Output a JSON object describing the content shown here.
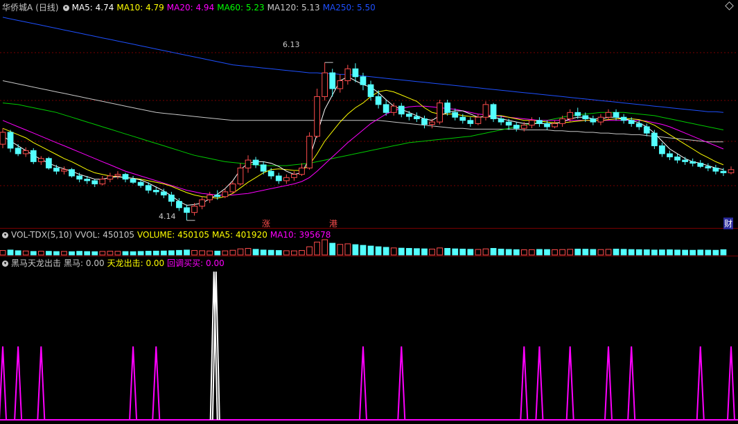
{
  "stock": {
    "name": "华侨城A",
    "period": "(日线)"
  },
  "main_panel": {
    "ma_labels": [
      {
        "text": "MA5: 4.74",
        "color": "#ffffff"
      },
      {
        "text": "MA10: 4.79",
        "color": "#ffff00"
      },
      {
        "text": "MA20: 4.94",
        "color": "#ff00ff"
      },
      {
        "text": "MA60: 5.23",
        "color": "#00ff00"
      },
      {
        "text": "MA120: 5.13",
        "color": "#c8c8c8"
      },
      {
        "text": "MA250: 5.50",
        "color": "#1e50ff"
      }
    ],
    "high_label": "6.13",
    "low_label": "4.14",
    "markers": [
      "涨",
      "港",
      "财"
    ]
  },
  "volume_panel": {
    "title": "VOL-TDX(5,10)",
    "labels": [
      {
        "text": "VVOL: 450105",
        "color": "#c8c8c8"
      },
      {
        "text": "VOLUME: 450105",
        "color": "#ffff00"
      },
      {
        "text": "MA5: 401920",
        "color": "#ffff00"
      },
      {
        "text": "MA10: 395678",
        "color": "#ff00ff"
      }
    ]
  },
  "indicator_panel": {
    "title": "黑马天龙出击",
    "labels": [
      {
        "text": "黑马: 0.00",
        "color": "#c8c8c8"
      },
      {
        "text": "天龙出击: 0.00",
        "color": "#ffff00"
      },
      {
        "text": "回调买买: 0.00",
        "color": "#ff00ff"
      }
    ]
  },
  "colors": {
    "up": "#ff4d4d",
    "down": "#54ffff",
    "grid": "#7a0000",
    "bg": "#000000"
  },
  "chart_data": {
    "type": "candlestick",
    "price_range": [
      4.14,
      6.13
    ],
    "candles": [
      [
        5.1,
        5.25,
        5.3,
        5.05
      ],
      [
        5.25,
        5.05,
        5.28,
        5.0
      ],
      [
        5.05,
        4.98,
        5.1,
        4.95
      ],
      [
        4.98,
        5.02,
        5.06,
        4.94
      ],
      [
        5.02,
        4.88,
        5.05,
        4.85
      ],
      [
        4.88,
        4.92,
        4.95,
        4.84
      ],
      [
        4.92,
        4.8,
        4.94,
        4.78
      ],
      [
        4.8,
        4.76,
        4.84,
        4.72
      ],
      [
        4.76,
        4.78,
        4.82,
        4.72
      ],
      [
        4.78,
        4.7,
        4.8,
        4.68
      ],
      [
        4.7,
        4.66,
        4.74,
        4.62
      ],
      [
        4.66,
        4.64,
        4.7,
        4.6
      ],
      [
        4.64,
        4.6,
        4.66,
        4.56
      ],
      [
        4.6,
        4.66,
        4.7,
        4.58
      ],
      [
        4.66,
        4.7,
        4.74,
        4.62
      ],
      [
        4.7,
        4.72,
        4.76,
        4.66
      ],
      [
        4.72,
        4.66,
        4.74,
        4.62
      ],
      [
        4.66,
        4.62,
        4.7,
        4.6
      ],
      [
        4.62,
        4.58,
        4.66,
        4.55
      ],
      [
        4.58,
        4.52,
        4.62,
        4.48
      ],
      [
        4.52,
        4.5,
        4.56,
        4.46
      ],
      [
        4.5,
        4.46,
        4.54,
        4.42
      ],
      [
        4.46,
        4.38,
        4.5,
        4.32
      ],
      [
        4.38,
        4.3,
        4.42,
        4.26
      ],
      [
        4.3,
        4.24,
        4.34,
        4.14
      ],
      [
        4.24,
        4.32,
        4.36,
        4.2
      ],
      [
        4.32,
        4.4,
        4.44,
        4.28
      ],
      [
        4.4,
        4.46,
        4.5,
        4.36
      ],
      [
        4.46,
        4.44,
        4.52,
        4.4
      ],
      [
        4.44,
        4.5,
        4.54,
        4.42
      ],
      [
        4.5,
        4.6,
        4.64,
        4.48
      ],
      [
        4.6,
        4.8,
        4.86,
        4.58
      ],
      [
        4.8,
        4.9,
        4.96,
        4.74
      ],
      [
        4.9,
        4.84,
        4.94,
        4.8
      ],
      [
        4.84,
        4.76,
        4.88,
        4.72
      ],
      [
        4.76,
        4.7,
        4.8,
        4.66
      ],
      [
        4.7,
        4.64,
        4.74,
        4.6
      ],
      [
        4.64,
        4.68,
        4.72,
        4.6
      ],
      [
        4.68,
        4.72,
        4.76,
        4.64
      ],
      [
        4.72,
        4.8,
        4.86,
        4.7
      ],
      [
        4.8,
        5.2,
        5.25,
        4.78
      ],
      [
        5.2,
        5.7,
        5.8,
        5.18
      ],
      [
        5.7,
        6.0,
        6.13,
        5.65
      ],
      [
        6.0,
        5.8,
        6.05,
        5.7
      ],
      [
        5.8,
        5.9,
        5.98,
        5.75
      ],
      [
        5.9,
        6.05,
        6.1,
        5.85
      ],
      [
        6.05,
        5.95,
        6.12,
        5.88
      ],
      [
        5.95,
        5.85,
        6.0,
        5.78
      ],
      [
        5.85,
        5.7,
        5.9,
        5.65
      ],
      [
        5.7,
        5.6,
        5.78,
        5.55
      ],
      [
        5.6,
        5.5,
        5.66,
        5.46
      ],
      [
        5.5,
        5.58,
        5.62,
        5.46
      ],
      [
        5.58,
        5.48,
        5.62,
        5.44
      ],
      [
        5.48,
        5.45,
        5.52,
        5.4
      ],
      [
        5.45,
        5.42,
        5.5,
        5.38
      ],
      [
        5.42,
        5.35,
        5.46,
        5.3
      ],
      [
        5.35,
        5.38,
        5.42,
        5.3
      ],
      [
        5.38,
        5.62,
        5.66,
        5.35
      ],
      [
        5.62,
        5.5,
        5.66,
        5.46
      ],
      [
        5.5,
        5.44,
        5.55,
        5.4
      ],
      [
        5.44,
        5.4,
        5.48,
        5.36
      ],
      [
        5.4,
        5.36,
        5.44,
        5.32
      ],
      [
        5.36,
        5.44,
        5.48,
        5.34
      ],
      [
        5.44,
        5.6,
        5.64,
        5.4
      ],
      [
        5.6,
        5.42,
        5.62,
        5.38
      ],
      [
        5.42,
        5.38,
        5.46,
        5.34
      ],
      [
        5.38,
        5.34,
        5.42,
        5.28
      ],
      [
        5.34,
        5.3,
        5.38,
        5.26
      ],
      [
        5.3,
        5.34,
        5.38,
        5.26
      ],
      [
        5.34,
        5.4,
        5.44,
        5.3
      ],
      [
        5.4,
        5.36,
        5.44,
        5.32
      ],
      [
        5.36,
        5.32,
        5.4,
        5.28
      ],
      [
        5.32,
        5.36,
        5.4,
        5.3
      ],
      [
        5.36,
        5.42,
        5.46,
        5.32
      ],
      [
        5.42,
        5.5,
        5.54,
        5.38
      ],
      [
        5.5,
        5.46,
        5.56,
        5.42
      ],
      [
        5.46,
        5.42,
        5.5,
        5.38
      ],
      [
        5.42,
        5.38,
        5.46,
        5.34
      ],
      [
        5.38,
        5.44,
        5.48,
        5.34
      ],
      [
        5.44,
        5.5,
        5.54,
        5.4
      ],
      [
        5.5,
        5.44,
        5.54,
        5.4
      ],
      [
        5.44,
        5.4,
        5.48,
        5.36
      ],
      [
        5.4,
        5.36,
        5.44,
        5.32
      ],
      [
        5.36,
        5.32,
        5.4,
        5.28
      ],
      [
        5.32,
        5.24,
        5.36,
        5.2
      ],
      [
        5.24,
        5.08,
        5.28,
        5.04
      ],
      [
        5.08,
        4.98,
        5.12,
        4.94
      ],
      [
        4.98,
        4.94,
        5.02,
        4.9
      ],
      [
        4.94,
        4.9,
        4.98,
        4.86
      ],
      [
        4.9,
        4.88,
        4.94,
        4.84
      ],
      [
        4.88,
        4.86,
        4.92,
        4.82
      ],
      [
        4.86,
        4.82,
        4.9,
        4.8
      ],
      [
        4.82,
        4.8,
        4.86,
        4.76
      ],
      [
        4.8,
        4.76,
        4.84,
        4.72
      ],
      [
        4.76,
        4.74,
        4.8,
        4.7
      ],
      [
        4.74,
        4.78,
        4.82,
        4.72
      ]
    ],
    "ma5": [
      5.2,
      5.14,
      5.08,
      5.02,
      4.96,
      4.91,
      4.86,
      4.82,
      4.79,
      4.76,
      4.72,
      4.69,
      4.66,
      4.66,
      4.68,
      4.69,
      4.68,
      4.67,
      4.65,
      4.61,
      4.56,
      4.51,
      4.45,
      4.38,
      4.33,
      4.34,
      4.36,
      4.41,
      4.47,
      4.54,
      4.64,
      4.78,
      4.86,
      4.88,
      4.88,
      4.86,
      4.82,
      4.76,
      4.72,
      4.74,
      4.92,
      5.23,
      5.54,
      5.72,
      5.9,
      5.95,
      5.9,
      5.85,
      5.82,
      5.75,
      5.66,
      5.58,
      5.54,
      5.5,
      5.46,
      5.42,
      5.4,
      5.46,
      5.5,
      5.52,
      5.52,
      5.48,
      5.44,
      5.45,
      5.44,
      5.42,
      5.4,
      5.38,
      5.36,
      5.36,
      5.36,
      5.36,
      5.36,
      5.38,
      5.42,
      5.44,
      5.44,
      5.42,
      5.42,
      5.44,
      5.44,
      5.42,
      5.4,
      5.37,
      5.32,
      5.24,
      5.14,
      5.04,
      4.98,
      4.92,
      4.88,
      4.86,
      4.83,
      4.8,
      4.78
    ],
    "ma10": [
      5.3,
      5.26,
      5.22,
      5.18,
      5.12,
      5.07,
      5.02,
      4.97,
      4.92,
      4.88,
      4.83,
      4.78,
      4.74,
      4.72,
      4.7,
      4.69,
      4.68,
      4.67,
      4.66,
      4.64,
      4.62,
      4.6,
      4.57,
      4.53,
      4.49,
      4.46,
      4.44,
      4.43,
      4.42,
      4.44,
      4.48,
      4.55,
      4.62,
      4.68,
      4.74,
      4.78,
      4.79,
      4.78,
      4.77,
      4.77,
      4.84,
      4.98,
      5.14,
      5.26,
      5.38,
      5.48,
      5.56,
      5.62,
      5.7,
      5.76,
      5.78,
      5.76,
      5.72,
      5.68,
      5.64,
      5.56,
      5.5,
      5.48,
      5.48,
      5.48,
      5.46,
      5.45,
      5.44,
      5.45,
      5.46,
      5.46,
      5.44,
      5.42,
      5.4,
      5.4,
      5.39,
      5.38,
      5.37,
      5.37,
      5.38,
      5.39,
      5.4,
      5.4,
      5.4,
      5.41,
      5.42,
      5.42,
      5.42,
      5.41,
      5.38,
      5.34,
      5.28,
      5.22,
      5.16,
      5.1,
      5.04,
      4.98,
      4.93,
      4.88,
      4.84
    ],
    "ma20": [
      5.4,
      5.36,
      5.32,
      5.28,
      5.24,
      5.2,
      5.16,
      5.12,
      5.08,
      5.04,
      5.0,
      4.96,
      4.92,
      4.88,
      4.84,
      4.8,
      4.76,
      4.73,
      4.7,
      4.67,
      4.64,
      4.61,
      4.58,
      4.55,
      4.52,
      4.5,
      4.48,
      4.47,
      4.46,
      4.46,
      4.46,
      4.47,
      4.48,
      4.5,
      4.52,
      4.54,
      4.56,
      4.58,
      4.6,
      4.63,
      4.68,
      4.76,
      4.85,
      4.94,
      5.03,
      5.12,
      5.2,
      5.28,
      5.36,
      5.42,
      5.48,
      5.52,
      5.55,
      5.57,
      5.58,
      5.58,
      5.57,
      5.56,
      5.55,
      5.54,
      5.52,
      5.5,
      5.48,
      5.47,
      5.46,
      5.45,
      5.44,
      5.43,
      5.42,
      5.41,
      5.4,
      5.4,
      5.4,
      5.4,
      5.4,
      5.4,
      5.4,
      5.4,
      5.4,
      5.4,
      5.4,
      5.4,
      5.4,
      5.4,
      5.39,
      5.37,
      5.35,
      5.32,
      5.28,
      5.24,
      5.2,
      5.16,
      5.12,
      5.08,
      5.04
    ],
    "ma60": [
      5.62,
      5.61,
      5.6,
      5.58,
      5.56,
      5.54,
      5.52,
      5.5,
      5.47,
      5.44,
      5.41,
      5.38,
      5.35,
      5.32,
      5.29,
      5.26,
      5.23,
      5.2,
      5.17,
      5.14,
      5.11,
      5.08,
      5.05,
      5.02,
      4.99,
      4.96,
      4.94,
      4.92,
      4.9,
      4.88,
      4.87,
      4.86,
      4.85,
      4.84,
      4.83,
      4.83,
      4.83,
      4.83,
      4.84,
      4.85,
      4.86,
      4.88,
      4.9,
      4.92,
      4.94,
      4.96,
      4.98,
      5.0,
      5.02,
      5.04,
      5.06,
      5.08,
      5.1,
      5.12,
      5.13,
      5.14,
      5.15,
      5.16,
      5.17,
      5.18,
      5.19,
      5.2,
      5.22,
      5.24,
      5.26,
      5.28,
      5.3,
      5.32,
      5.34,
      5.36,
      5.38,
      5.4,
      5.42,
      5.44,
      5.46,
      5.47,
      5.48,
      5.49,
      5.5,
      5.5,
      5.5,
      5.5,
      5.49,
      5.48,
      5.47,
      5.46,
      5.44,
      5.42,
      5.4,
      5.38,
      5.36,
      5.34,
      5.32,
      5.3,
      5.28
    ],
    "ma120": [
      5.9,
      5.88,
      5.86,
      5.84,
      5.82,
      5.8,
      5.78,
      5.76,
      5.74,
      5.72,
      5.7,
      5.68,
      5.66,
      5.64,
      5.62,
      5.6,
      5.58,
      5.56,
      5.54,
      5.52,
      5.5,
      5.49,
      5.48,
      5.47,
      5.46,
      5.45,
      5.44,
      5.43,
      5.42,
      5.41,
      5.4,
      5.4,
      5.4,
      5.4,
      5.4,
      5.4,
      5.4,
      5.4,
      5.4,
      5.4,
      5.4,
      5.4,
      5.4,
      5.4,
      5.4,
      5.4,
      5.4,
      5.4,
      5.4,
      5.4,
      5.39,
      5.38,
      5.37,
      5.36,
      5.35,
      5.34,
      5.33,
      5.32,
      5.31,
      5.3,
      5.3,
      5.29,
      5.29,
      5.29,
      5.29,
      5.29,
      5.29,
      5.29,
      5.28,
      5.28,
      5.28,
      5.28,
      5.27,
      5.27,
      5.26,
      5.26,
      5.25,
      5.25,
      5.24,
      5.24,
      5.23,
      5.23,
      5.22,
      5.22,
      5.21,
      5.2,
      5.19,
      5.18,
      5.17,
      5.16,
      5.15,
      5.14,
      5.13,
      5.13,
      5.13
    ],
    "ma250": [
      6.7,
      6.68,
      6.66,
      6.64,
      6.62,
      6.6,
      6.58,
      6.56,
      6.54,
      6.52,
      6.5,
      6.48,
      6.46,
      6.44,
      6.42,
      6.4,
      6.38,
      6.36,
      6.34,
      6.32,
      6.3,
      6.28,
      6.26,
      6.24,
      6.22,
      6.2,
      6.18,
      6.16,
      6.14,
      6.12,
      6.1,
      6.09,
      6.08,
      6.07,
      6.06,
      6.05,
      6.04,
      6.03,
      6.02,
      6.01,
      6.0,
      6.0,
      5.99,
      5.99,
      5.98,
      5.98,
      5.97,
      5.96,
      5.95,
      5.94,
      5.93,
      5.92,
      5.91,
      5.9,
      5.89,
      5.88,
      5.87,
      5.86,
      5.85,
      5.84,
      5.83,
      5.82,
      5.81,
      5.8,
      5.79,
      5.78,
      5.77,
      5.76,
      5.75,
      5.74,
      5.73,
      5.72,
      5.71,
      5.7,
      5.69,
      5.68,
      5.67,
      5.66,
      5.65,
      5.64,
      5.63,
      5.62,
      5.61,
      5.6,
      5.59,
      5.58,
      5.57,
      5.56,
      5.55,
      5.54,
      5.53,
      5.52,
      5.51,
      5.51,
      5.5
    ],
    "volume": [
      380,
      420,
      360,
      340,
      300,
      320,
      310,
      290,
      300,
      280,
      310,
      290,
      280,
      300,
      320,
      310,
      290,
      280,
      300,
      320,
      330,
      340,
      360,
      390,
      420,
      380,
      360,
      340,
      330,
      350,
      400,
      520,
      560,
      480,
      420,
      400,
      380,
      360,
      350,
      380,
      700,
      1100,
      1300,
      1000,
      900,
      950,
      880,
      820,
      760,
      700,
      650,
      600,
      580,
      560,
      540,
      520,
      500,
      600,
      560,
      520,
      500,
      480,
      470,
      520,
      560,
      500,
      470,
      450,
      440,
      450,
      470,
      460,
      450,
      460,
      480,
      500,
      490,
      470,
      460,
      480,
      500,
      480,
      460,
      450,
      440,
      420,
      430,
      440,
      420,
      410,
      400,
      420,
      410,
      400,
      450
    ],
    "indicator": {
      "黑马_spikes": [
        27,
        28
      ],
      "回调买买_spikes": [
        0,
        2,
        5,
        17,
        20,
        47,
        52,
        68,
        70,
        74,
        79,
        82,
        91,
        95
      ]
    }
  }
}
